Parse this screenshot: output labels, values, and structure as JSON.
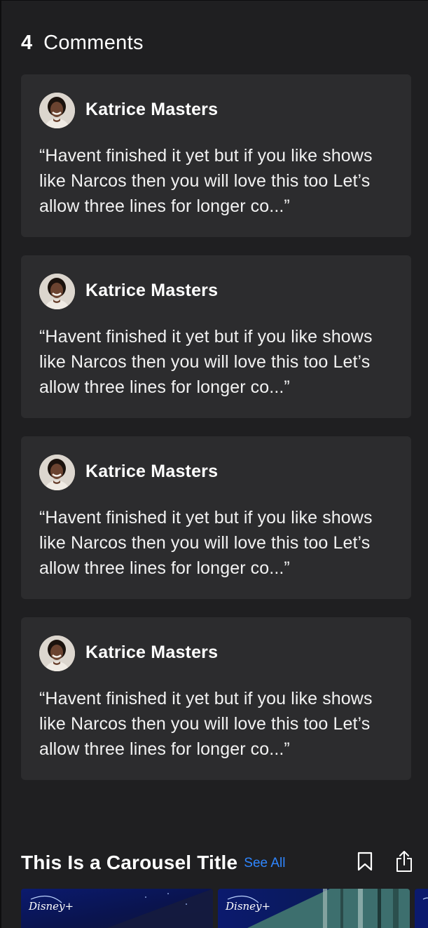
{
  "comments": {
    "count": "4",
    "title": "Comments",
    "items": [
      {
        "author": "Katrice Masters",
        "text": "“Havent finished it yet but if you like shows like Narcos then you will love this too Let’s allow three lines for longer co...”",
        "avatar_icon": "person-photo"
      },
      {
        "author": "Katrice Masters",
        "text": "“Havent finished it yet but if you like shows like Narcos then you will love this too Let’s allow three lines for longer co...”",
        "avatar_icon": "person-photo"
      },
      {
        "author": "Katrice Masters",
        "text": "“Havent finished it yet but if you like shows like Narcos then you will love this too Let’s allow three lines for longer co...”",
        "avatar_icon": "person-photo"
      },
      {
        "author": "Katrice Masters",
        "text": "“Havent finished it yet but if you like shows like Narcos then you will love this too Let’s allow three lines for longer co...”",
        "avatar_icon": "person-photo"
      }
    ]
  },
  "carousel": {
    "title": "This Is a Carousel Title",
    "see_all": "See All",
    "bookmark_icon": "bookmark-icon",
    "share_icon": "share-icon",
    "tiles": [
      {
        "logo": "Disney+"
      },
      {
        "logo": "Disney+"
      }
    ]
  },
  "colors": {
    "background": "#1f1f21",
    "card": "#2c2c2e",
    "link": "#2f86ff"
  }
}
